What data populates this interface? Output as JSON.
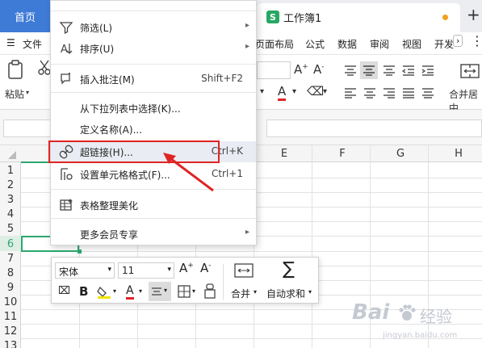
{
  "titlebar": {
    "home_tab": "首页",
    "doc_tab": "工作簿1",
    "doc_icon_letter": "S",
    "new_tab": "+"
  },
  "menu": {
    "file": "文件",
    "items": [
      "页面布局",
      "公式",
      "数据",
      "审阅",
      "视图",
      "开发"
    ]
  },
  "ribbon": {
    "paste_label": "粘贴",
    "merge_label": "合并居中",
    "font_grow": "A⁺",
    "font_shrink": "A⁻",
    "font_color_letter": "A"
  },
  "columns": [
    "E",
    "F",
    "G",
    "H"
  ],
  "rows": [
    "1",
    "2",
    "3",
    "4",
    "5",
    "6",
    "7",
    "8",
    "9",
    "10",
    "11",
    "12",
    "13"
  ],
  "context_menu": {
    "filter": "筛选(L)",
    "sort": "排序(U)",
    "insert_comment": "插入批注(M)",
    "insert_comment_shortcut": "Shift+F2",
    "pick_from_list": "从下拉列表中选择(K)...",
    "define_name": "定义名称(A)...",
    "hyperlink": "超链接(H)...",
    "hyperlink_shortcut": "Ctrl+K",
    "format_cells": "设置单元格格式(F)...",
    "format_cells_shortcut": "Ctrl+1",
    "beautify": "表格整理美化",
    "member": "更多会员专享"
  },
  "mini_toolbar": {
    "font_name": "宋体",
    "font_size": "11",
    "bold": "B",
    "font_color_letter": "A",
    "merge": "合并",
    "autosum": "自动求和"
  },
  "watermark": {
    "brand": "Bai",
    "brand2": "经验",
    "url": "jingyan.baidu.com"
  },
  "colors": {
    "accent_blue": "#3e7bd6",
    "active_green": "#2ba86f",
    "highlight_red": "#e02424"
  }
}
